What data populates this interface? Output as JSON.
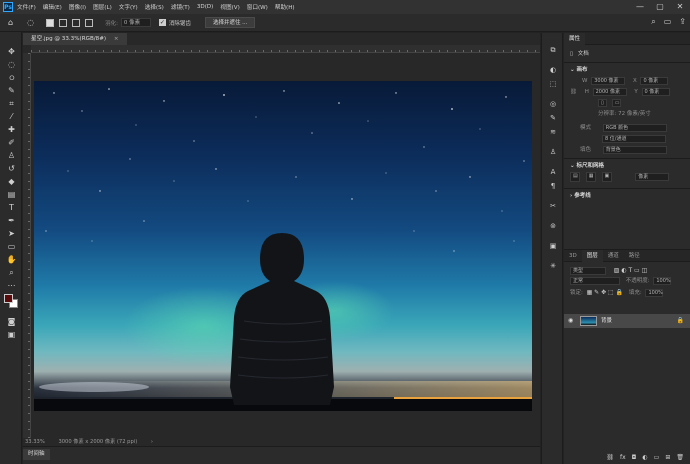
{
  "app": {
    "logo": "Ps"
  },
  "menu": [
    "文件(F)",
    "编辑(E)",
    "图像(I)",
    "图层(L)",
    "文字(Y)",
    "选择(S)",
    "滤镜(T)",
    "3D(D)",
    "视图(V)",
    "窗口(W)",
    "帮助(H)"
  ],
  "window_controls": {
    "minimize": "—",
    "maximize": "▢",
    "close": "✕"
  },
  "options": {
    "feather_label": "羽化:",
    "feather_value": "0 像素",
    "antialias_label": "消除锯齿",
    "select_mask_button": "选择并遮住 ..."
  },
  "document": {
    "tab_title": "星空.jpg @ 33.3%(RGB/8#)",
    "tab_close": "×",
    "zoom": "33.33%",
    "dimensions": "3000 像素 x 2000 像素 (72 ppi)",
    "status_arrow": "›"
  },
  "timeline": {
    "label": "时间轴"
  },
  "properties": {
    "tabs": [
      "属性"
    ],
    "doc_label": "文档",
    "canvas_section": "画布",
    "w_label": "W",
    "w_value": "3000 像素",
    "h_label": "H",
    "h_value": "2000 像素",
    "x_label": "X",
    "x_value": "0 像素",
    "y_label": "Y",
    "y_value": "0 像素",
    "resolution": "分辨率: 72 像素/英寸",
    "mode_label": "模式",
    "mode_value": "RGB 颜色",
    "depth_value": "8 位/通道",
    "fill_label": "填色",
    "fill_value": "背景色",
    "rulers_section": "标尺和网格",
    "ruler_unit": "像素",
    "guides_section": "参考线"
  },
  "layers": {
    "tabs": [
      "3D",
      "图层",
      "通道",
      "路径"
    ],
    "kind_label": "类型",
    "blend_mode": "正常",
    "opacity_label": "不透明度:",
    "opacity_value": "100%",
    "lock_label": "锁定:",
    "fill_label": "填充:",
    "fill_value": "100%",
    "layer_name": "背景"
  },
  "colors": {
    "accent": "#31a8ff",
    "panel": "#2b2b2b",
    "canvas_bg": "#282828"
  }
}
